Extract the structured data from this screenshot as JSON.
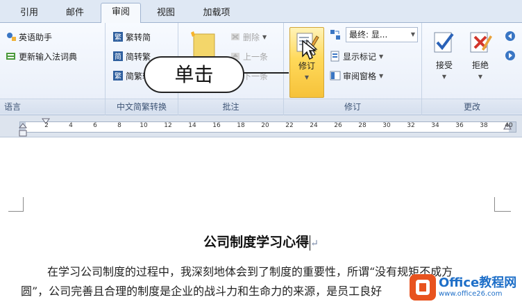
{
  "tabs": [
    {
      "label": "引用",
      "active": false
    },
    {
      "label": "邮件",
      "active": false
    },
    {
      "label": "审阅",
      "active": true
    },
    {
      "label": "视图",
      "active": false
    },
    {
      "label": "加载项",
      "active": false
    }
  ],
  "ribbon": {
    "language": {
      "label": "语言",
      "items": [
        "英语助手",
        "更新输入法词典"
      ]
    },
    "chinese_conversion": {
      "label": "中文简繁转换",
      "items": [
        "繁转简",
        "简转繁",
        "简繁转换"
      ]
    },
    "comments": {
      "label": "批注",
      "items": [
        "删除",
        "上一条",
        "下一条"
      ]
    },
    "tracking": {
      "label": "修订",
      "track_changes": "修订",
      "display_for_review": "最终: 显...",
      "show_markup": "显示标记",
      "reviewing_pane": "审阅窗格"
    },
    "changes": {
      "label": "更改",
      "accept": "接受",
      "reject": "拒绝"
    }
  },
  "callout": "单击",
  "ruler": {
    "ticks": [
      "2",
      "4",
      "6",
      "8",
      "10",
      "12",
      "14",
      "16",
      "18",
      "20",
      "22",
      "24",
      "26",
      "28",
      "30",
      "32",
      "34",
      "36",
      "38",
      "40"
    ]
  },
  "document": {
    "title": "公司制度学习心得",
    "line1": "在学习公司制度的过程中，我深刻地体会到了制度的重要性，所谓“没有规矩不成方",
    "line2": "圆”，公司完善且合理的制度是企业的战斗力和生命力的来源，是员工良好"
  },
  "watermark": {
    "main": "Office教程网",
    "sub": "www.office26.com"
  },
  "colors": {
    "pressed_button": "#ffd95a",
    "ribbon_bg": "#e8eef8",
    "watermark_orange": "#e8531f",
    "watermark_blue": "#1e6fc8"
  }
}
